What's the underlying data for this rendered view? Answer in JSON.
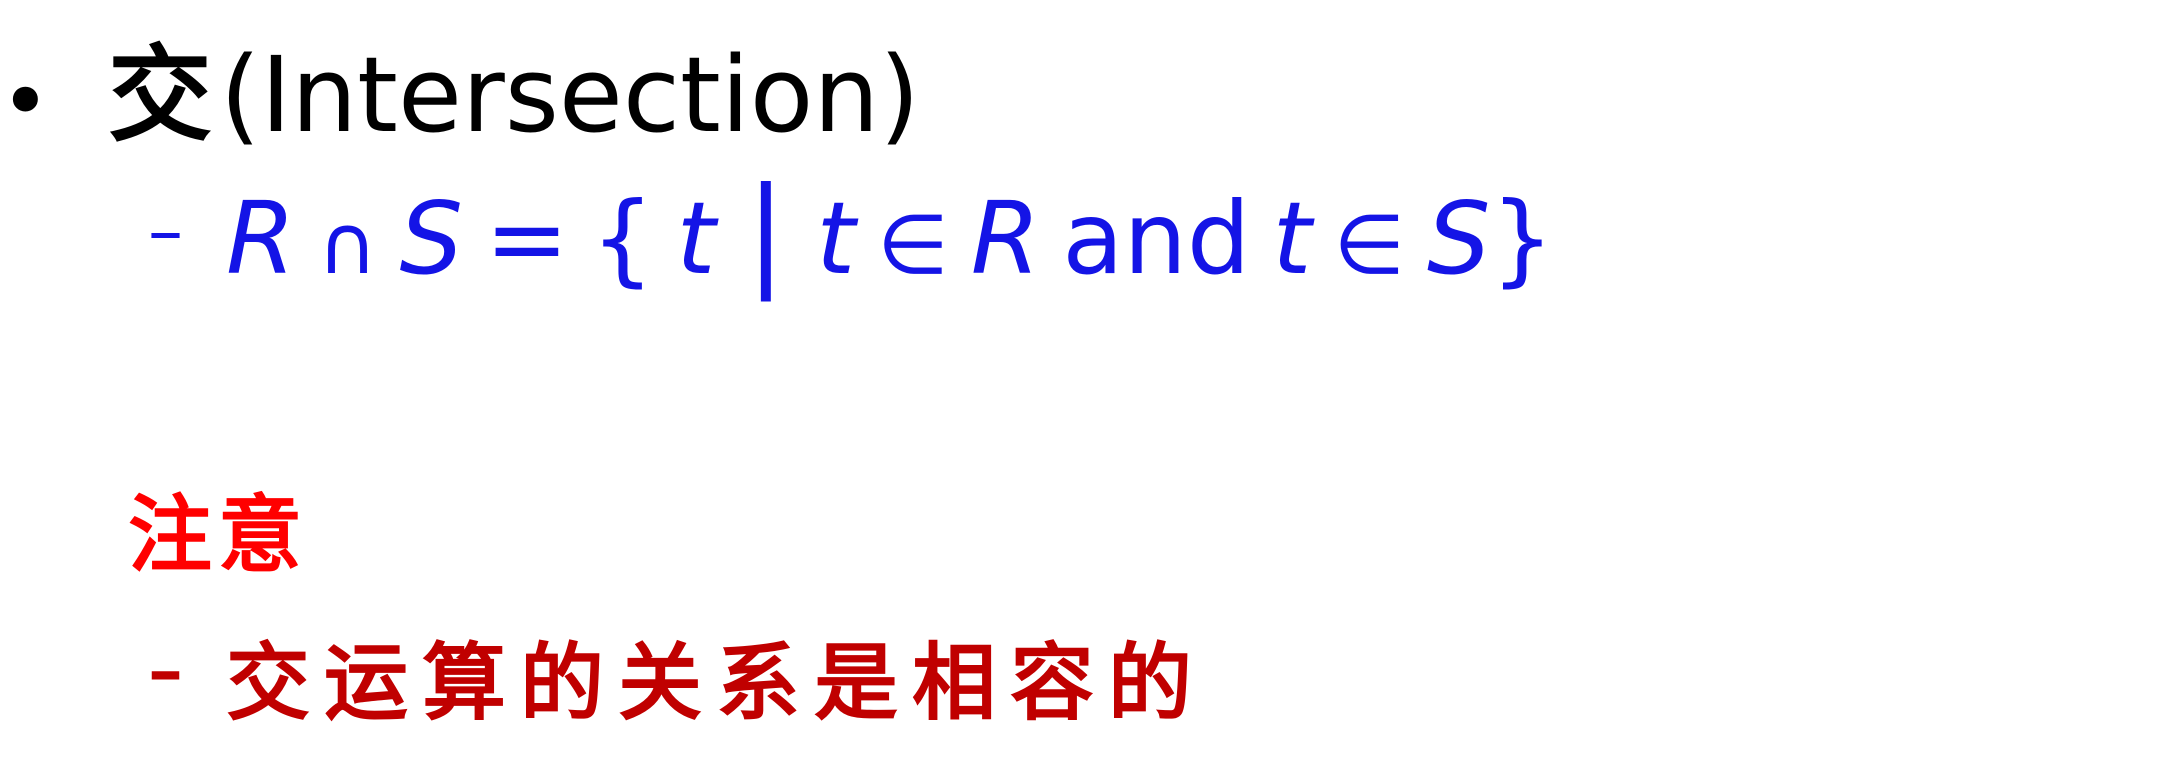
{
  "heading": {
    "bullet": "•",
    "cjk": "交",
    "latin": "(Intersection)"
  },
  "formula": {
    "dash": "–",
    "R1": "R",
    "cap": "∩",
    "S1": "S",
    "eq": "=",
    "lbrace": "{",
    "t1": "t",
    "bar": "|",
    "t2": "t",
    "in1": "∈",
    "R2": "R",
    "and": "and",
    "t3": "t",
    "in2": "∈",
    "S2": "S",
    "rbrace": "}"
  },
  "note": {
    "title": "注意",
    "dash": "–",
    "body": "交运算的关系是相容的"
  },
  "colors": {
    "formula": "#1414e6",
    "note_title": "#ff0000",
    "note_body": "#c00000",
    "heading": "#000000"
  }
}
